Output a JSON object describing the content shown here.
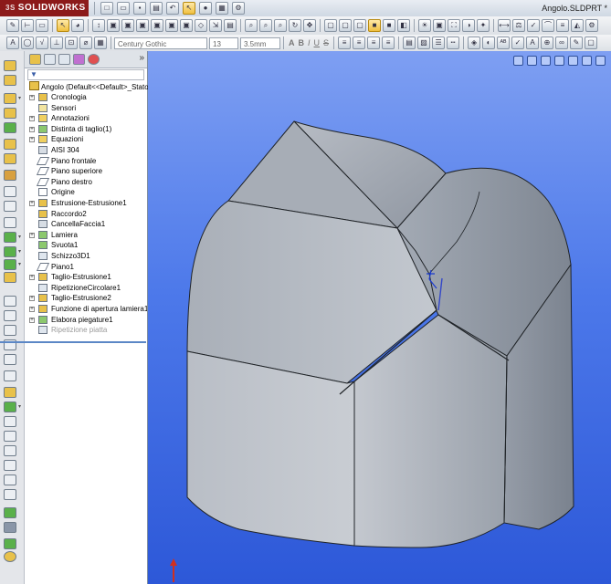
{
  "app": {
    "logo_text": "SOLIDWORKS",
    "logo_prefix": "3S"
  },
  "window": {
    "document_title": "Angolo.SLDPRT *"
  },
  "format_bar": {
    "font_family": "Century Gothic",
    "font_size": "13",
    "line_height": "3.5mm"
  },
  "tree": {
    "root": "Angolo (Default<<Default>_Stato",
    "items": [
      {
        "label": "Cronologia",
        "icon": "history-icon",
        "expandable": true
      },
      {
        "label": "Sensori",
        "icon": "sensor-icon",
        "expandable": false
      },
      {
        "label": "Annotazioni",
        "icon": "annotation-icon",
        "expandable": true
      },
      {
        "label": "Distinta di taglio(1)",
        "icon": "cut-list-icon",
        "expandable": true
      },
      {
        "label": "Equazioni",
        "icon": "equations-icon",
        "expandable": true
      },
      {
        "label": "AISI 304",
        "icon": "material-icon",
        "expandable": false
      },
      {
        "label": "Piano frontale",
        "icon": "plane-icon",
        "expandable": false
      },
      {
        "label": "Piano superiore",
        "icon": "plane-icon",
        "expandable": false
      },
      {
        "label": "Piano destro",
        "icon": "plane-icon",
        "expandable": false
      },
      {
        "label": "Origine",
        "icon": "origin-icon",
        "expandable": false
      },
      {
        "label": "Estrusione-Estrusione1",
        "icon": "extrude-icon",
        "expandable": true
      },
      {
        "label": "Raccordo2",
        "icon": "fillet-icon",
        "expandable": false
      },
      {
        "label": "CancellaFaccia1",
        "icon": "delete-face-icon",
        "expandable": false
      },
      {
        "label": "Lamiera",
        "icon": "sheet-metal-icon",
        "expandable": true
      },
      {
        "label": "Svuota1",
        "icon": "shell-icon",
        "expandable": false
      },
      {
        "label": "Schizzo3D1",
        "icon": "sketch3d-icon",
        "expandable": false
      },
      {
        "label": "Piano1",
        "icon": "plane-icon",
        "expandable": false
      },
      {
        "label": "Taglio-Estrusione1",
        "icon": "cut-extrude-icon",
        "expandable": true
      },
      {
        "label": "RipetizioneCircolare1",
        "icon": "circular-pattern-icon",
        "expandable": false
      },
      {
        "label": "Taglio-Estrusione2",
        "icon": "cut-extrude-icon",
        "expandable": true
      },
      {
        "label": "Funzione di apertura lamiera1",
        "icon": "rip-icon",
        "expandable": true
      },
      {
        "label": "Elabora piegature1",
        "icon": "process-bends-icon",
        "expandable": true
      },
      {
        "label": "Ripetizione piatta",
        "icon": "flat-pattern-icon",
        "expandable": false,
        "suppressed": true
      }
    ]
  },
  "colors": {
    "viewport_top": "#7e9ff2",
    "viewport_bottom": "#2d58d8",
    "model": "#b4bac4",
    "logo_bg": "#8c1a1a"
  }
}
